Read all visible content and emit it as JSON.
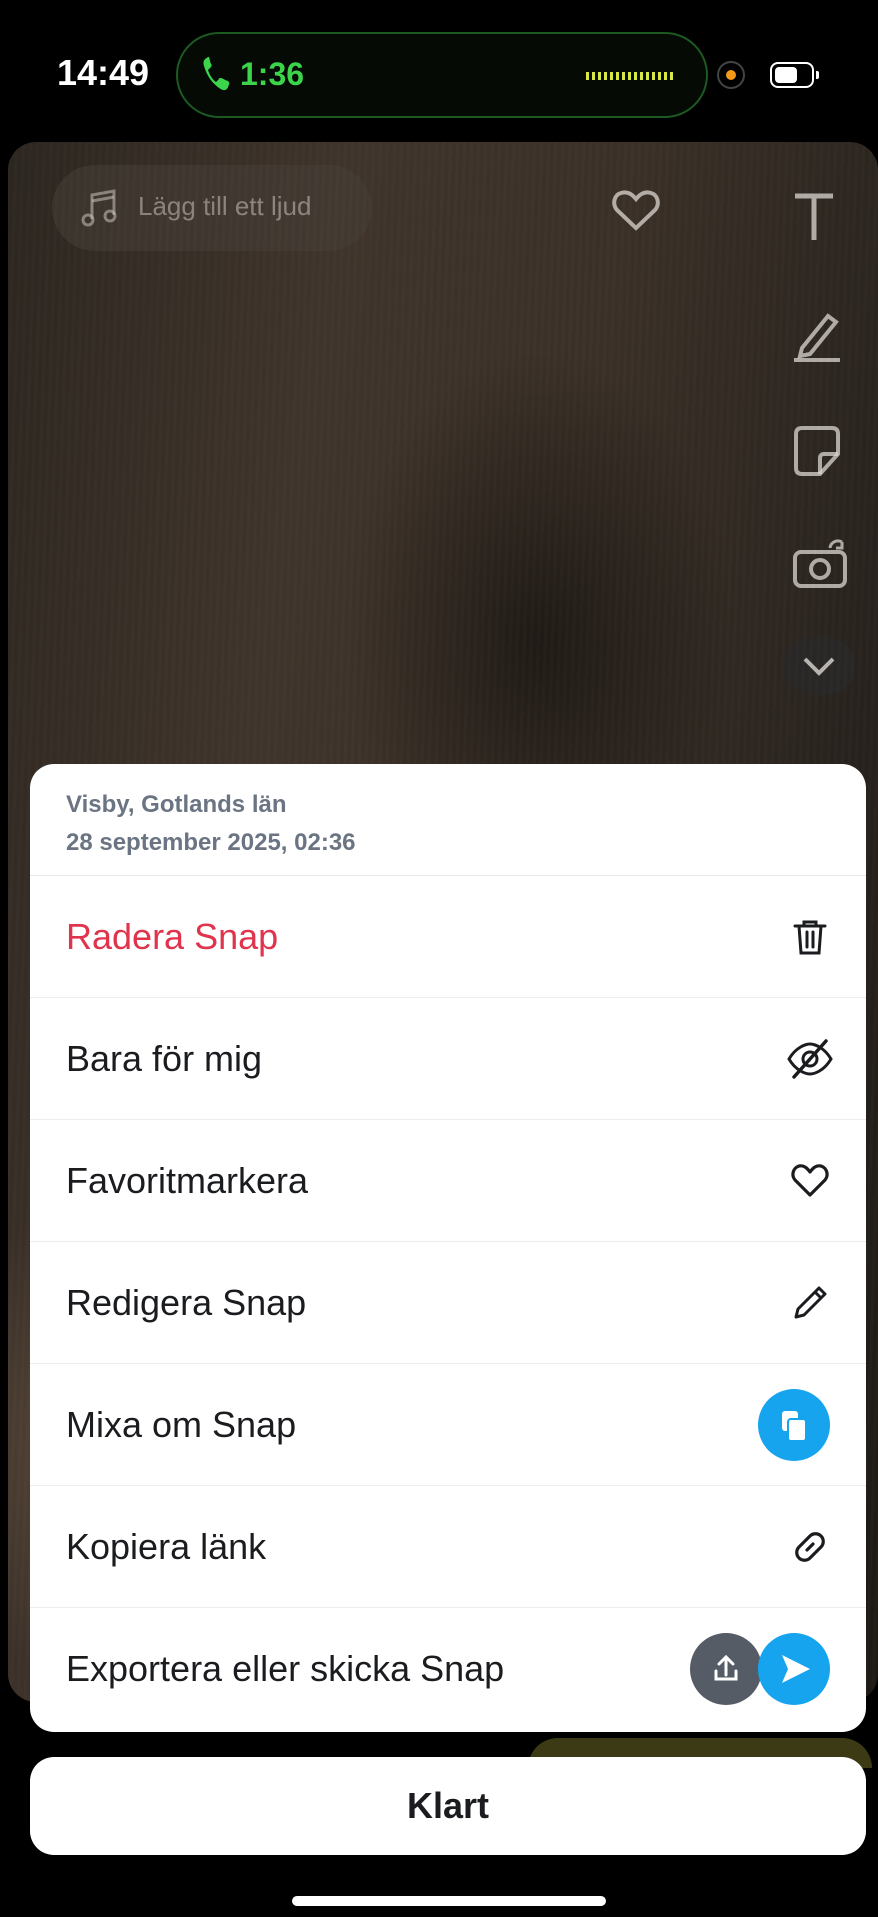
{
  "status_bar": {
    "time": "14:49",
    "call_duration": "1:36",
    "call_color": "#3cd44a"
  },
  "editor": {
    "add_sound_label": "Lägg till ett ljud",
    "tools": [
      "text-tool-icon",
      "pencil-icon",
      "sticker-icon",
      "camera-flip-icon",
      "chevron-down-icon"
    ]
  },
  "sheet": {
    "location": "Visby, Gotlands län",
    "timestamp": "28 september 2025, 02:36",
    "items": [
      {
        "label": "Radera Snap",
        "icon": "trash-icon",
        "color": "#e0344d"
      },
      {
        "label": "Bara för mig",
        "icon": "eye-slash-icon"
      },
      {
        "label": "Favoritmarkera",
        "icon": "heart-icon"
      },
      {
        "label": "Redigera Snap",
        "icon": "pencil-icon"
      },
      {
        "label": "Mixa om Snap",
        "icon": "remix-icon"
      },
      {
        "label": "Kopiera länk",
        "icon": "link-icon"
      },
      {
        "label": "Exportera eller skicka Snap",
        "icon": "export-send-icons"
      }
    ]
  },
  "done_button": {
    "label": "Klart"
  },
  "colors": {
    "accent_blue": "#16a4ef",
    "danger": "#e0344d"
  }
}
